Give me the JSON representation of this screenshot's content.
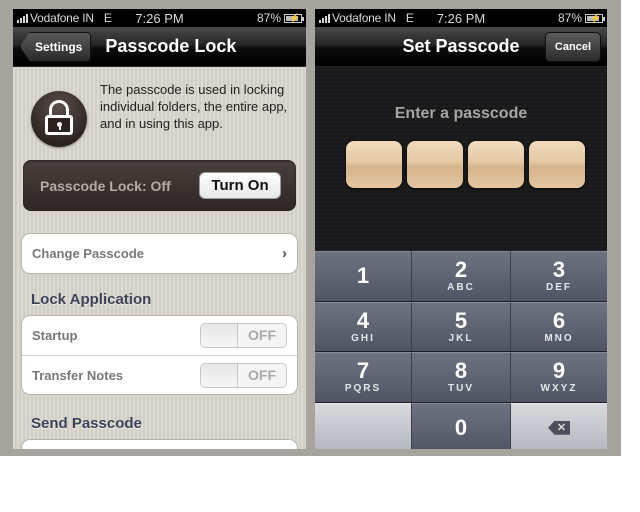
{
  "status_bar": {
    "carrier": "Vodafone IN",
    "network": "E",
    "time": "7:26 PM",
    "battery_percent": "87%",
    "battery_level": 0.87
  },
  "left_screen": {
    "nav": {
      "back_label": "Settings",
      "title": "Passcode Lock"
    },
    "info_text": "The passcode is used in locking individual folders, the entire app, and in using this app.",
    "lock_status": "Passcode Lock: Off",
    "turn_on_label": "Turn On",
    "change_passcode_label": "Change Passcode",
    "lock_application": {
      "title": "Lock Application",
      "items": [
        {
          "label": "Startup",
          "state": "OFF"
        },
        {
          "label": "Transfer Notes",
          "state": "OFF"
        }
      ]
    },
    "send_passcode_title": "Send Passcode"
  },
  "right_screen": {
    "nav": {
      "title": "Set Passcode",
      "cancel_label": "Cancel"
    },
    "prompt": "Enter a passcode",
    "code_length": 4,
    "keypad": [
      {
        "num": "1",
        "letters": ""
      },
      {
        "num": "2",
        "letters": "ABC"
      },
      {
        "num": "3",
        "letters": "DEF"
      },
      {
        "num": "4",
        "letters": "GHI"
      },
      {
        "num": "5",
        "letters": "JKL"
      },
      {
        "num": "6",
        "letters": "MNO"
      },
      {
        "num": "7",
        "letters": "PQRS"
      },
      {
        "num": "8",
        "letters": "TUV"
      },
      {
        "num": "9",
        "letters": "WXYZ"
      },
      {
        "num": "",
        "letters": ""
      },
      {
        "num": "0",
        "letters": ""
      },
      {
        "num": "",
        "letters": "",
        "icon": "delete-icon"
      }
    ]
  }
}
